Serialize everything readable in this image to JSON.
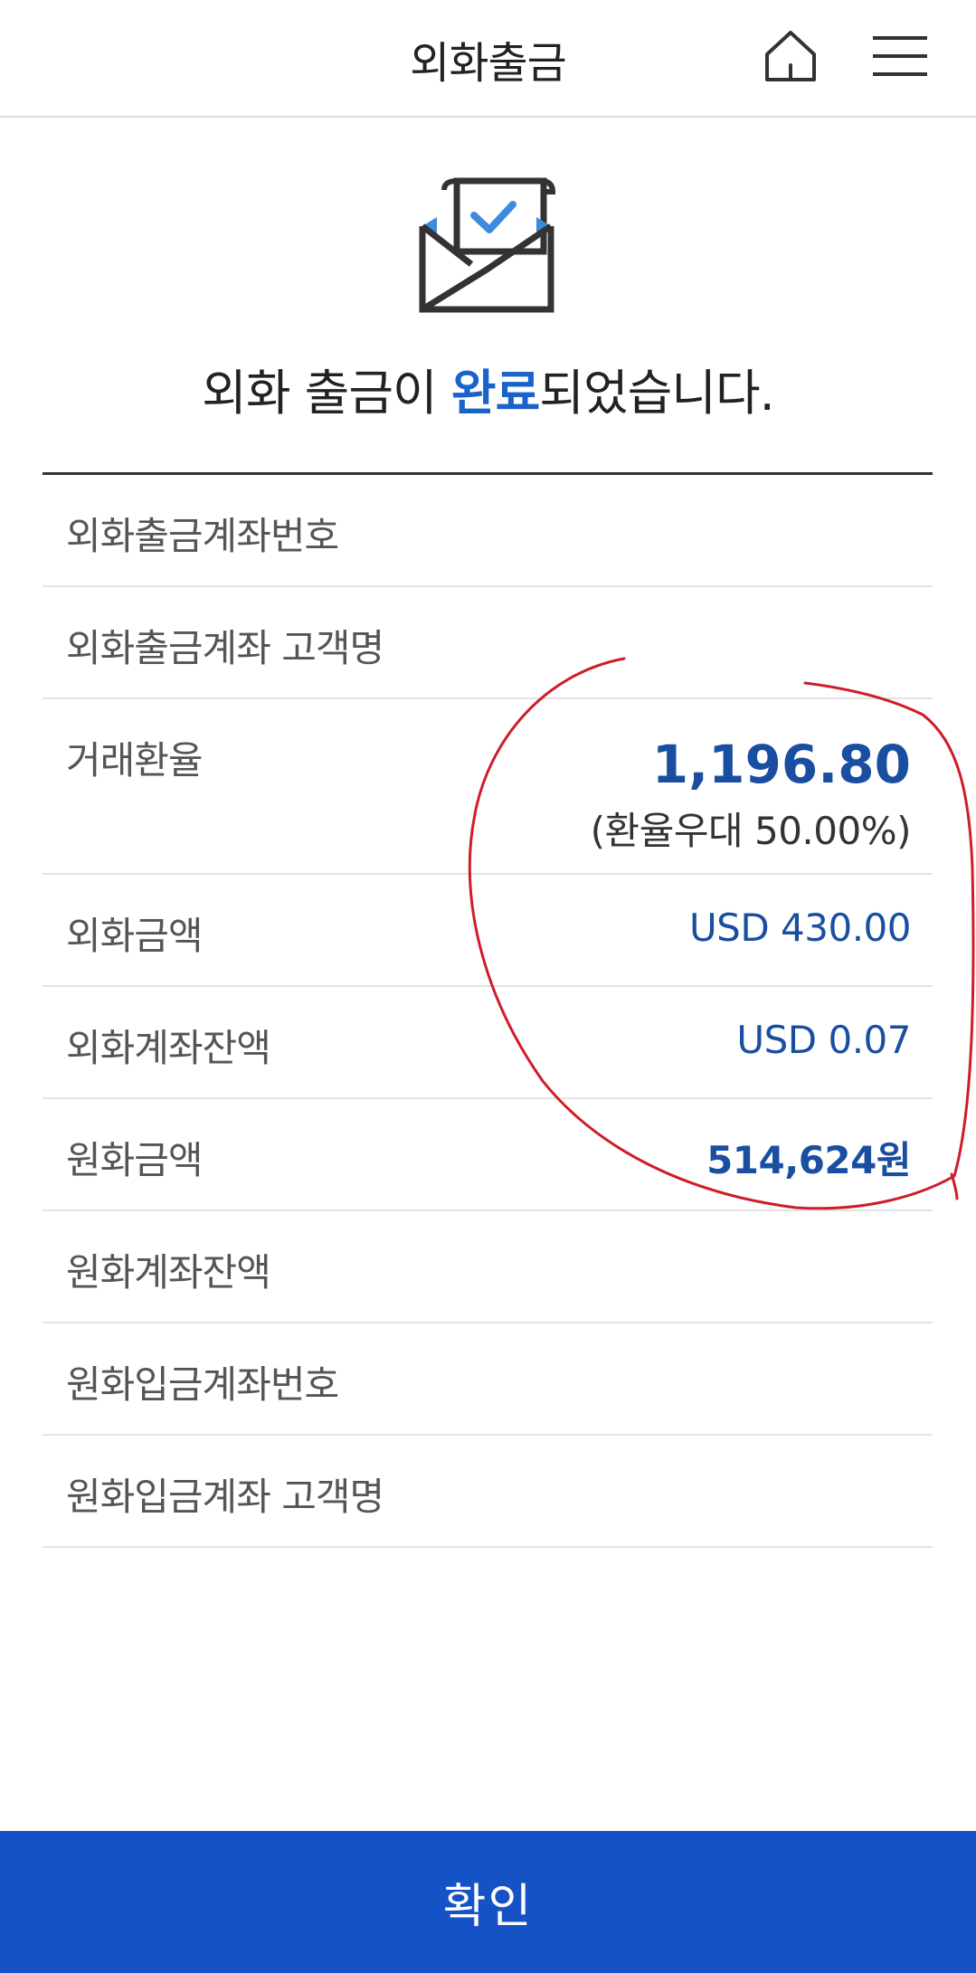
{
  "header": {
    "title": "외화출금",
    "home_icon": "home-icon",
    "menu_icon": "menu-icon"
  },
  "result": {
    "icon": "envelope-check-icon",
    "message_before": "외화 출금이 ",
    "message_accent": "완료",
    "message_after": "되었습니다.",
    "accent_color": "#1a63c9"
  },
  "details": {
    "fx_withdraw_account_label": "외화출금계좌번호",
    "fx_withdraw_holder_label": "외화출금계좌 고객명",
    "exchange_rate_label": "거래환율",
    "exchange_rate_value": "1,196.80",
    "exchange_rate_note": "(환율우대 50.00%)",
    "fx_amount_label": "외화금액",
    "fx_amount_value": "USD 430.00",
    "fx_balance_label": "외화계좌잔액",
    "fx_balance_value": "USD 0.07",
    "krw_amount_label": "원화금액",
    "krw_amount_value": "514,624원",
    "krw_balance_label": "원화계좌잔액",
    "krw_deposit_account_label": "원화입금계좌번호",
    "krw_deposit_holder_label": "원화입금계좌 고객명"
  },
  "footer": {
    "confirm_label": "확인",
    "button_color": "#1452c6"
  }
}
